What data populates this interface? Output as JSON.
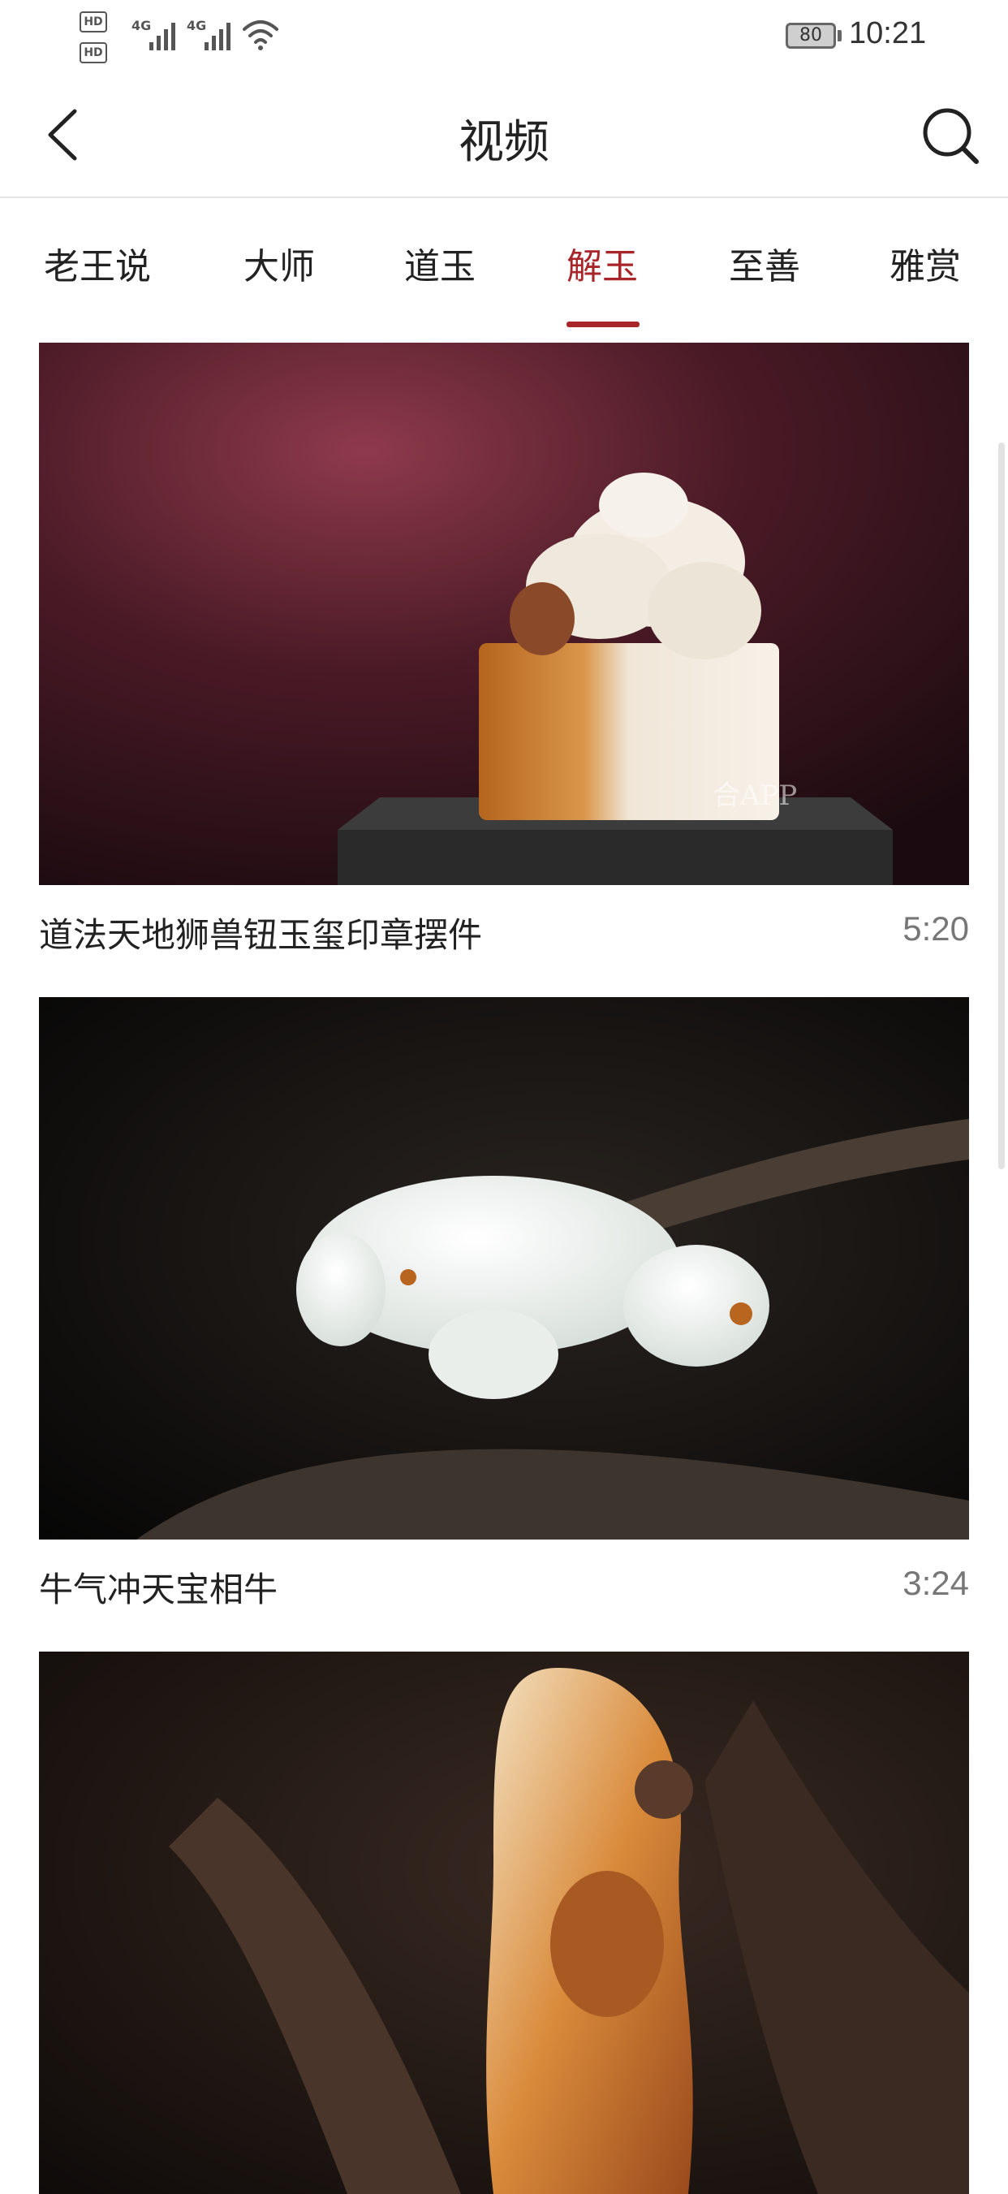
{
  "status_bar": {
    "hd1": "HD",
    "hd2": "HD",
    "net1": "4G",
    "net2": "4G",
    "battery": "80",
    "time": "10:21"
  },
  "header": {
    "title": "视频"
  },
  "tabs": [
    {
      "label": "老王说",
      "active": false
    },
    {
      "label": "大师",
      "active": false
    },
    {
      "label": "道玉",
      "active": false
    },
    {
      "label": "解玉",
      "active": true
    },
    {
      "label": "至善",
      "active": false
    },
    {
      "label": "雅赏",
      "active": false
    }
  ],
  "videos": [
    {
      "title": "道法天地狮兽钮玉玺印章摆件",
      "duration": "5:20",
      "watermark": "合APP"
    },
    {
      "title": "牛气冲天宝相牛",
      "duration": "3:24"
    },
    {
      "title": "",
      "duration": ""
    }
  ],
  "colors": {
    "accent": "#a8262a",
    "text": "#222222",
    "muted": "#777777"
  }
}
